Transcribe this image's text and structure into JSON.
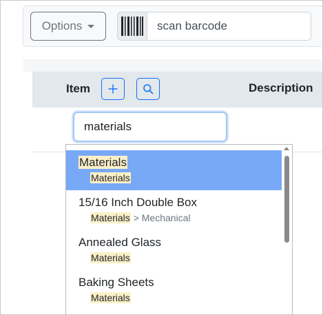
{
  "toolbar": {
    "options_label": "Options",
    "barcode_placeholder": "scan barcode"
  },
  "table": {
    "headers": {
      "item": "Item",
      "description": "Description"
    },
    "item_input_value": "materials"
  },
  "dropdown": {
    "items": [
      {
        "title": "Materials",
        "title_highlight": "Materials",
        "title_rest": "",
        "path": "Materials",
        "path_rest": "",
        "active": true
      },
      {
        "title": "15/16 Inch Double Box",
        "path": "Materials",
        "path_sep": ">",
        "path_rest": "Mechanical",
        "active": false
      },
      {
        "title": "Annealed Glass",
        "path": "Materials",
        "path_rest": "",
        "active": false
      },
      {
        "title": "Baking Sheets",
        "path": "Materials",
        "path_rest": "",
        "active": false
      }
    ]
  },
  "icons": {
    "barcode": "barcode-icon",
    "add": "plus-icon",
    "search": "search-icon",
    "caret": "caret-down-icon"
  },
  "colors": {
    "primary": "#0d6efd",
    "active_item": "#78a9f7",
    "highlight": "#fcf0c8"
  }
}
